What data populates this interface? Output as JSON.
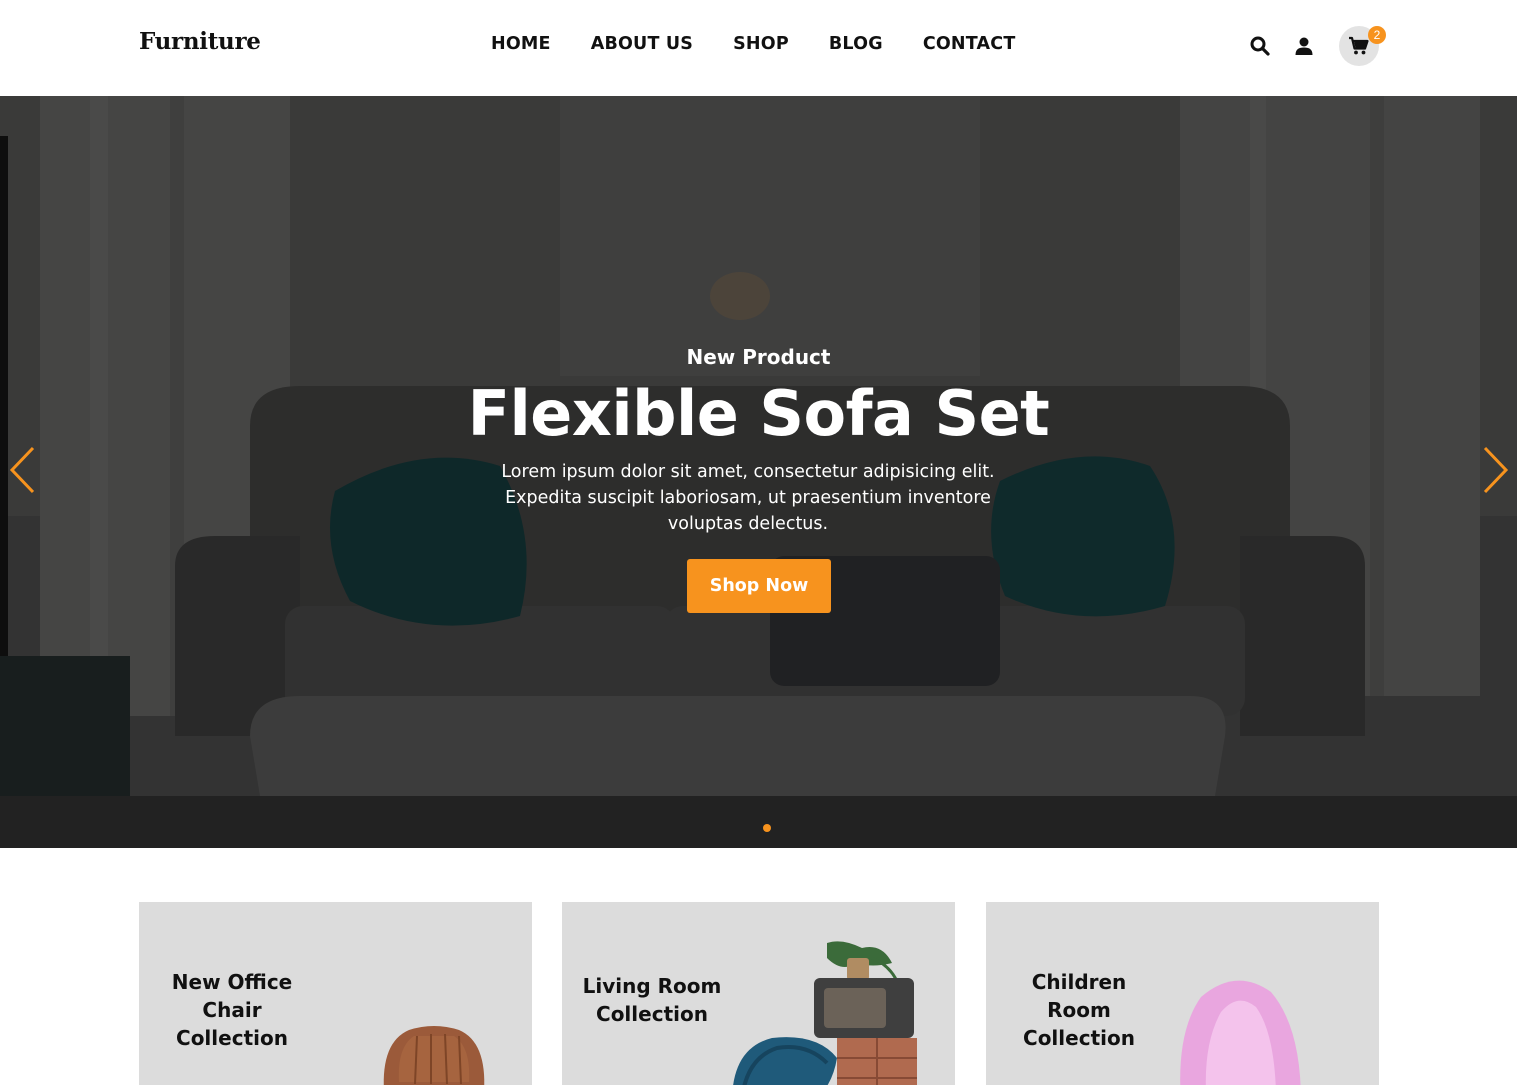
{
  "header": {
    "logo": "Furniture",
    "nav": [
      "HOME",
      "ABOUT US",
      "SHOP",
      "BLOG",
      "CONTACT"
    ],
    "icons": [
      "search-icon",
      "user-icon",
      "cart-icon"
    ],
    "cart_count": "2"
  },
  "hero": {
    "subtitle": "New Product",
    "title": "Flexible Sofa Set",
    "text": "Lorem ipsum dolor sit amet, consectetur adipisicing elit. Expedita suscipit laboriosam, ut praesentium inventore voluptas delectus.",
    "button": "Shop Now",
    "slide_index": 1,
    "slide_count": 1
  },
  "collections": [
    {
      "title": "New Office Chair Collection"
    },
    {
      "title": "Living Room Collection"
    },
    {
      "title": "Children Room Collection"
    }
  ],
  "colors": {
    "accent": "#f7931e",
    "card_bg": "#dcdcdc",
    "text": "#111111"
  }
}
